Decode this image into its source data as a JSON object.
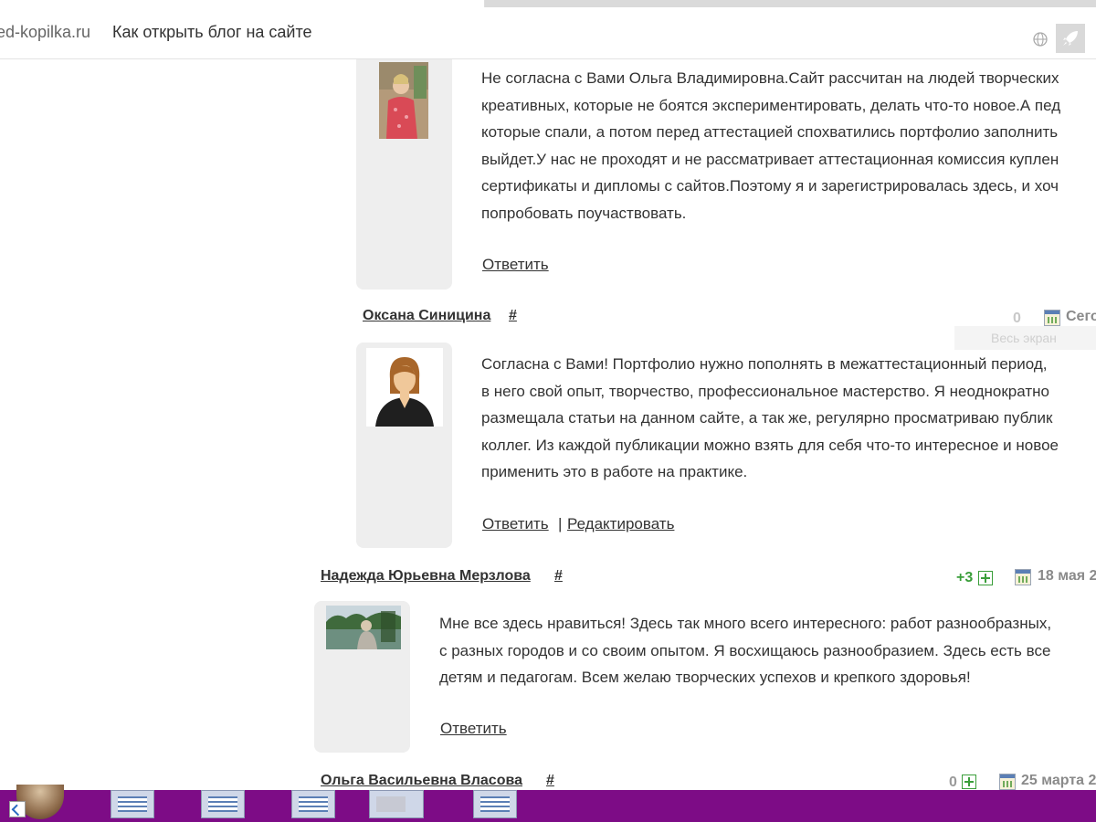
{
  "browser": {
    "domain": "ed-kopilka.ru",
    "page_title": "Как открыть блог на сайте",
    "icons": [
      "globe-icon",
      "rocket-icon"
    ]
  },
  "comments": [
    {
      "lines": [
        "Не согласна с Вами Ольга Владимировна.Сайт рассчитан на людей творческих",
        "креативных, которые не боятся экспериментировать, делать что-то новое.А пед",
        "которые спали, а потом перед аттестацией спохватились портфолио заполнить",
        "выйдет.У нас не проходят и не рассматривает аттестационная комиссия куплен",
        "сертификаты и дипломы с сайтов.Поэтому я и зарегистрировалась здесь, и хоч",
        "попробовать поучаствовать."
      ],
      "reply": "Ответить"
    },
    {
      "author": "Оксана Синицина",
      "hash": "#",
      "rating": "0",
      "date": "Сего",
      "lines": [
        "Согласна с Вами! Портфолио нужно пополнять в межаттестационный период,",
        "в него свой опыт, творчество, профессиональное мастерство. Я неоднократно",
        "размещала статьи на данном сайте, а так же, регулярно просматриваю публик",
        "коллег. Из каждой публикации можно взять для себя что-то интересное и новое",
        "применить это в работе на практике."
      ],
      "reply": "Ответить",
      "separator": "|",
      "edit": "Редактировать"
    },
    {
      "author": "Надежда Юрьевна Мерзлова",
      "hash": "#",
      "rating": "+3",
      "date": "18 мая 2",
      "lines": [
        "Мне все здесь нравиться! Здесь так много всего интересного: работ разнообразных,",
        "с разных городов и со своим опытом. Я восхищаюсь разнообразием. Здесь есть все",
        "детям и педагогам. Всем желаю творческих успехов и крепкого здоровья!"
      ],
      "reply": "Ответить"
    },
    {
      "author": "Ольга Васильевна Власова",
      "hash": "#",
      "rating": "0",
      "date": "25 марта 2"
    }
  ],
  "overlay": {
    "fullscreen_label": "Весь экран"
  },
  "colors": {
    "rating_positive": "#3a9e3a",
    "rating_zero": "#9a9a9a",
    "taskbar": "#7d0c86",
    "avatar_column": "#eeeeee"
  }
}
